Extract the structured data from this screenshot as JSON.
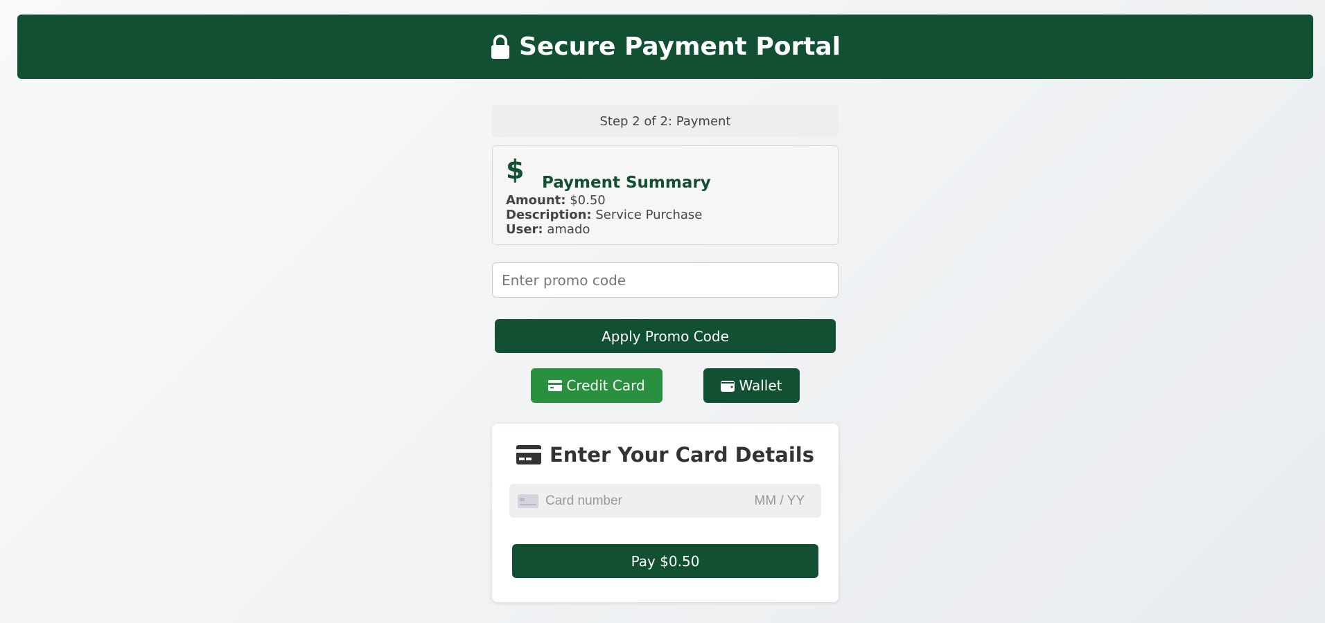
{
  "header": {
    "title": "Secure Payment Portal",
    "icon": "lock-icon"
  },
  "step": {
    "text": "Step 2 of 2: Payment"
  },
  "summary": {
    "icon": "dollar-icon",
    "icon_glyph": "$",
    "title": "Payment Summary",
    "amount_label": "Amount:",
    "amount_value": "$0.50",
    "description_label": "Description:",
    "description_value": "Service Purchase",
    "user_label": "User:",
    "user_value": "amado"
  },
  "promo": {
    "placeholder": "Enter promo code",
    "value": ""
  },
  "apply_button": {
    "label": "Apply Promo Code"
  },
  "methods": {
    "credit_card": {
      "label": "Credit Card",
      "icon": "credit-card-icon",
      "active": true
    },
    "wallet": {
      "label": "Wallet",
      "icon": "wallet-icon",
      "active": false
    }
  },
  "card_form": {
    "icon": "credit-card-icon",
    "title": "Enter Your Card Details",
    "card_number_placeholder": "Card number",
    "expiry_placeholder": "MM / YY"
  },
  "pay_button": {
    "label": "Pay $0.50"
  },
  "colors": {
    "primary": "#115033",
    "active_method": "#29903f",
    "background": "#f8f9fa"
  }
}
